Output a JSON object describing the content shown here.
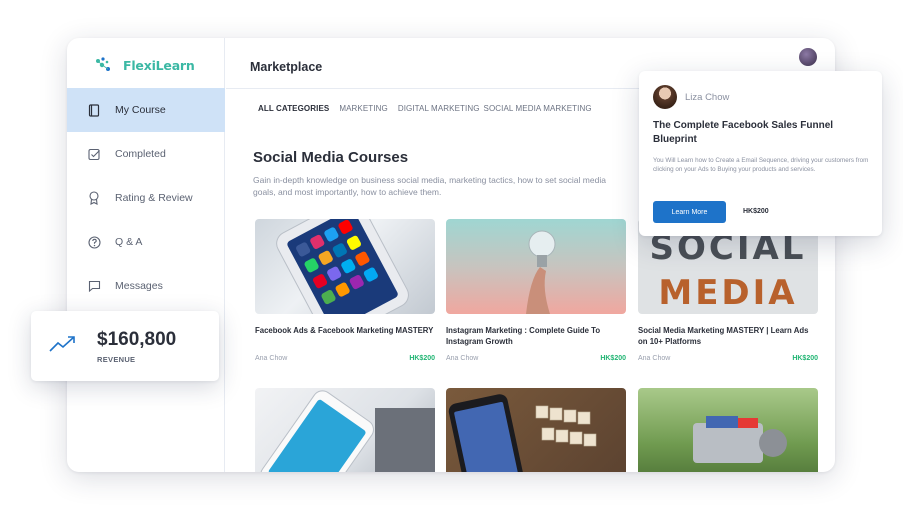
{
  "app": {
    "logo_text": "FlexiLearn"
  },
  "sidebar": {
    "items": [
      {
        "label": "My Course",
        "icon": "book-icon",
        "active": true
      },
      {
        "label": "Completed",
        "icon": "completed-icon",
        "active": false
      },
      {
        "label": "Rating & Review",
        "icon": "ribbon-icon",
        "active": false
      },
      {
        "label": "Q & A",
        "icon": "question-icon",
        "active": false
      },
      {
        "label": "Messages",
        "icon": "message-icon",
        "active": false
      }
    ]
  },
  "header": {
    "title": "Marketplace"
  },
  "categories": [
    "ALL CATEGORIES",
    "MARKETING",
    "DIGITAL MARKETING",
    "SOCIAL MEDIA MARKETING"
  ],
  "section": {
    "title": "Social Media Courses",
    "description": "Gain in-depth knowledge on business social media, marketing tactics, how to set social media goals, and most importantly, how to achieve them."
  },
  "courses": [
    {
      "title": "Facebook Ads & Facebook Marketing MASTERY",
      "author": "Ana Chow",
      "price": "HK$200"
    },
    {
      "title": "Instagram Marketing : Complete Guide To Instagram Growth",
      "author": "Ana Chow",
      "price": "HK$200"
    },
    {
      "title": "Social Media Marketing MASTERY | Learn Ads on 10+ Platforms",
      "author": "Ana Chow",
      "price": "HK$200"
    },
    {
      "title": "",
      "author": "",
      "price": ""
    },
    {
      "title": "",
      "author": "",
      "price": ""
    },
    {
      "title": "",
      "author": "",
      "price": ""
    }
  ],
  "thumb_texts": {
    "social": "SOCIAL",
    "media": "MEDIA"
  },
  "popover": {
    "author": "Liza Chow",
    "title": "The Complete Facebook Sales Funnel Blueprint",
    "description": "You Will Learn how to Create a Email Sequence, driving your customers from clicking on your Ads to Buying your products and services.",
    "button_label": "Learn More",
    "price": "HK$200"
  },
  "revenue": {
    "amount": "$160,800",
    "label": "REVENUE"
  },
  "colors": {
    "accent": "#1e73c9",
    "active_nav": "#cfe2f7",
    "price": "#21b573",
    "logo": "#3bb8a4"
  }
}
